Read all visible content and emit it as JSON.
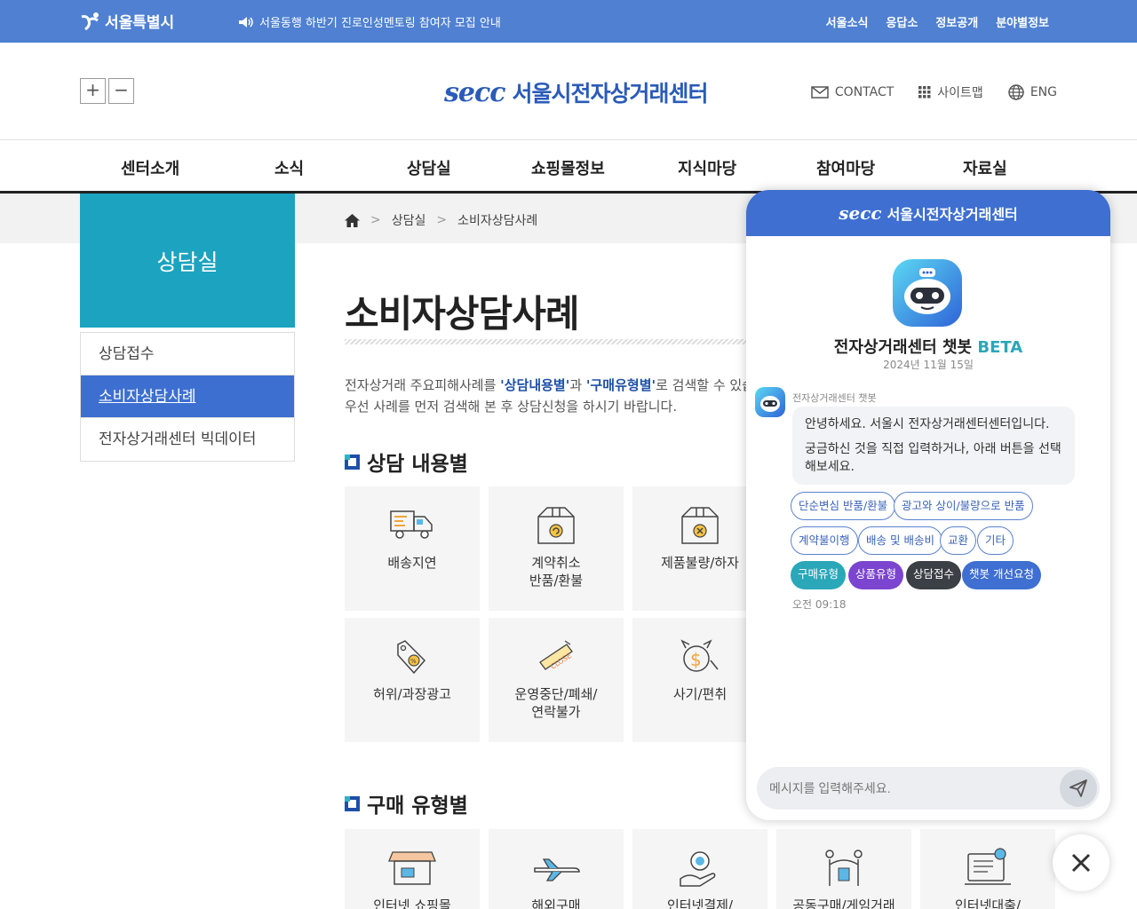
{
  "topbar": {
    "logo": "서울특별시",
    "notice": "서울동행 하반기 진로인성멘토링 참여자 모집 안내",
    "links": [
      "서울소식",
      "응답소",
      "정보공개",
      "분야별정보"
    ]
  },
  "header": {
    "zoom_in": "+",
    "zoom_out": "−",
    "brand_logo": "secc",
    "brand_name": "서울시전자상거래센터",
    "contact": "CONTACT",
    "sitemap": "사이트맵",
    "lang": "ENG"
  },
  "gnb": [
    "센터소개",
    "소식",
    "상담실",
    "쇼핑몰정보",
    "지식마당",
    "참여마당",
    "자료실"
  ],
  "breadcrumb": {
    "level1": "상담실",
    "level2": "소비자상담사례"
  },
  "lnb": {
    "title": "상담실",
    "items": [
      "상담접수",
      "소비자상담사례",
      "전자상거래센터 빅데이터"
    ]
  },
  "content": {
    "title": "소비자상담사례",
    "intro_prefix": "전자상거래 주요피해사례를 ",
    "intro_k1": "'상담내용별'",
    "intro_mid": "과 ",
    "intro_k2": "'구매유형별'",
    "intro_suffix": "로 검색할 수 있습니다.",
    "intro_line2": "우선 사례를 먼저 검색해 본 후 상담신청을 하시기 바랍니다.",
    "section1": "상담 내용별",
    "cards1": [
      {
        "label": "배송지연",
        "icon": "truck-icon"
      },
      {
        "label": "계약취소\n반품/환불",
        "icon": "return-box-icon"
      },
      {
        "label": "제품불량/하자",
        "icon": "defect-box-icon"
      },
      {
        "label": "허위/과장광고",
        "icon": "price-tag-icon"
      },
      {
        "label": "운영중단/폐쇄/\n연락불가",
        "icon": "close-sign-icon"
      },
      {
        "label": "사기/편취",
        "icon": "fraud-money-icon"
      }
    ],
    "section2": "구매 유형별",
    "cards2": [
      {
        "label": "인터넷 쇼핑몰",
        "icon": "store-icon"
      },
      {
        "label": "해외구매",
        "icon": "airplane-icon"
      },
      {
        "label": "인터넷결제/",
        "icon": "payment-hand-icon"
      },
      {
        "label": "공동구매/게임거래",
        "icon": "group-buy-icon"
      },
      {
        "label": "인터넷대출/",
        "icon": "online-loan-icon"
      }
    ]
  },
  "chat": {
    "header_logo": "secc",
    "header_title": "서울시전자상거래센터",
    "bot_name": "전자상거래센터 챗봇",
    "beta": "BETA",
    "date": "2024년 11월 15일",
    "sender": "전자상거래센터 챗봇",
    "msg1": "안녕하세요. 서울시 전자상거래센터센터입니다.",
    "msg2": "궁금하신 것을 직접 입력하거나, 아래 버튼을 선택해보세요.",
    "chips": [
      "단순변심 반품/환불",
      "광고와 상이/불량으로 반품",
      "계약불이행",
      "배송 및 배송비",
      "교환",
      "기타",
      "구매유형",
      "상품유형",
      "상담접수",
      "챗봇 개선요청"
    ],
    "time": "오전 09:18",
    "input_placeholder": "메시지를 입력해주세요."
  },
  "colors": {
    "topbar": "#4f80d2",
    "brand": "#2a5bb8",
    "lnb_title": "#1ca3c0",
    "lnb_active": "#3d6fd0",
    "chat_header": "#3e6fd1"
  }
}
